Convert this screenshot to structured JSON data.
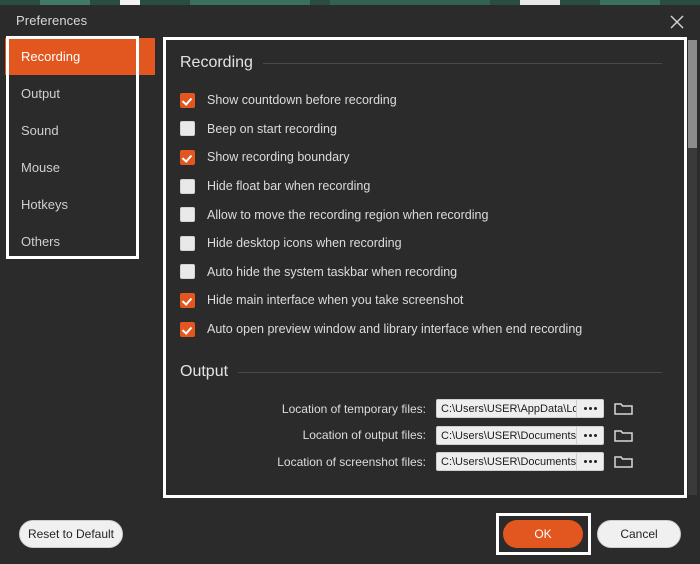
{
  "window": {
    "title": "Preferences",
    "close_icon": "close-icon"
  },
  "colors": {
    "accent": "#e2571f",
    "panel_bg": "#2b2b2b",
    "text": "#dcdcdc",
    "highlight_border": "#ffffff",
    "field_bg": "#eeeeee",
    "strip_bg": "#2a4d42"
  },
  "sidebar": {
    "items": [
      {
        "label": "Recording",
        "active": true
      },
      {
        "label": "Output",
        "active": false
      },
      {
        "label": "Sound",
        "active": false
      },
      {
        "label": "Mouse",
        "active": false
      },
      {
        "label": "Hotkeys",
        "active": false
      },
      {
        "label": "Others",
        "active": false
      }
    ]
  },
  "content": {
    "recording": {
      "heading": "Recording",
      "options": [
        {
          "label": "Show countdown before recording",
          "checked": true
        },
        {
          "label": "Beep on start recording",
          "checked": false
        },
        {
          "label": "Show recording boundary",
          "checked": true
        },
        {
          "label": "Hide float bar when recording",
          "checked": false
        },
        {
          "label": "Allow to move the recording region when recording",
          "checked": false
        },
        {
          "label": "Hide desktop icons when recording",
          "checked": false
        },
        {
          "label": "Auto hide the system taskbar when recording",
          "checked": false
        },
        {
          "label": "Hide main interface when you take screenshot",
          "checked": true
        },
        {
          "label": "Auto open preview window and library interface when end recording",
          "checked": true
        }
      ]
    },
    "output": {
      "heading": "Output",
      "fields": [
        {
          "label": "Location of temporary files:",
          "value": "C:\\Users\\USER\\AppData\\Local\\Ten",
          "browse_icon": "ellipsis-icon",
          "folder_icon": "folder-icon"
        },
        {
          "label": "Location of output files:",
          "value": "C:\\Users\\USER\\Documents\\Aiseeso",
          "browse_icon": "ellipsis-icon",
          "folder_icon": "folder-icon"
        },
        {
          "label": "Location of screenshot files:",
          "value": "C:\\Users\\USER\\Documents\\Aiseeso",
          "browse_icon": "ellipsis-icon",
          "folder_icon": "folder-icon"
        }
      ]
    }
  },
  "footer": {
    "reset_label": "Reset to Default",
    "ok_label": "OK",
    "cancel_label": "Cancel"
  }
}
